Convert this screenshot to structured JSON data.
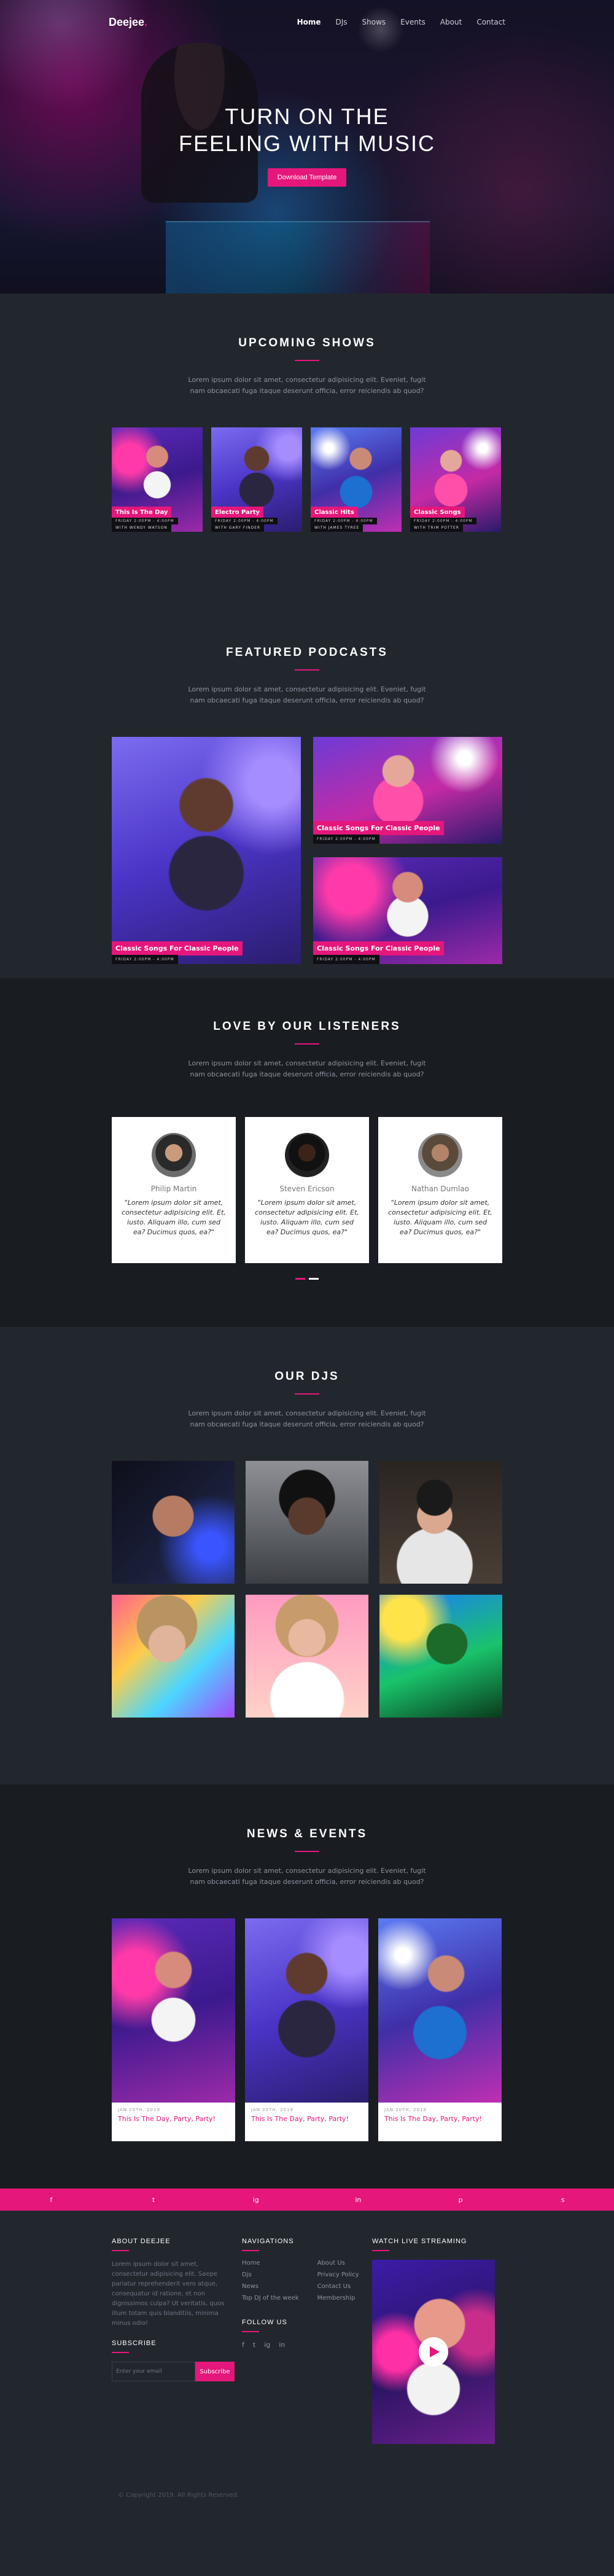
{
  "nav": {
    "logo": "Deejee",
    "logo_dot": ".",
    "items": [
      {
        "label": "Home",
        "active": true
      },
      {
        "label": "DJs",
        "active": false
      },
      {
        "label": "Shows",
        "active": false
      },
      {
        "label": "Events",
        "active": false
      },
      {
        "label": "About",
        "active": false
      },
      {
        "label": "Contact",
        "active": false
      }
    ]
  },
  "hero": {
    "line1": "TURN ON THE",
    "line2": "FEELING WITH MUSIC",
    "button": "Download Template"
  },
  "lorem": "Lorem ipsum dolor sit amet, consectetur adipisicing elit. Eveniet, fugit nam obcaecati fuga itaque deserunt officia, error reiciendis ab quod?",
  "shows": {
    "title": "UPCOMING SHOWS",
    "items": [
      {
        "title": "This Is The Day",
        "meta": "FRIDAY 2:00PM - 4:00PM",
        "host": "WITH WENDY WATSON"
      },
      {
        "title": "Electro Party",
        "meta": "FRIDAY 2:00PM - 4:00PM",
        "host": "WITH GARY FINDER"
      },
      {
        "title": "Classic Hits",
        "meta": "FRIDAY 2:00PM - 4:00PM",
        "host": "WITH JAMES TYREE"
      },
      {
        "title": "Classic Songs",
        "meta": "FRIDAY 2:00PM - 4:00PM",
        "host": "WITH TRIM POTTER"
      }
    ]
  },
  "podcasts": {
    "title": "FEATURED PODCASTS",
    "items": [
      {
        "title": "Classic Songs For Classic People",
        "meta": "FRIDAY 2:00PM - 4:00PM"
      },
      {
        "title": "Classic Songs For Classic People",
        "meta": "FRIDAY 2:00PM - 4:00PM"
      },
      {
        "title": "Classic Songs For Classic People",
        "meta": "FRIDAY 2:00PM - 4:00PM"
      }
    ]
  },
  "listeners": {
    "title": "LOVE BY OUR LISTENERS",
    "items": [
      {
        "name": "Philip Martin",
        "quote": "\"Lorem ipsum dolor sit amet, consectetur adipisicing elit. Et, iusto. Aliquam illo, cum sed ea? Ducimus quos, ea?\""
      },
      {
        "name": "Steven Ericson",
        "quote": "\"Lorem ipsum dolor sit amet, consectetur adipisicing elit. Et, iusto. Aliquam illo, cum sed ea? Ducimus quos, ea?\""
      },
      {
        "name": "Nathan Dumlao",
        "quote": "\"Lorem ipsum dolor sit amet, consectetur adipisicing elit. Et, iusto. Aliquam illo, cum sed ea? Ducimus quos, ea?\""
      }
    ]
  },
  "djs": {
    "title": "OUR DJS"
  },
  "news": {
    "title": "NEWS & EVENTS",
    "items": [
      {
        "date": "JAN 20TH, 2019",
        "title": "This Is The Day, Party, Party!"
      },
      {
        "date": "JAN 20TH, 2019",
        "title": "This Is The Day, Party, Party!"
      },
      {
        "date": "JAN 20TH, 2019",
        "title": "This Is The Day, Party, Party!"
      }
    ]
  },
  "social": [
    "f",
    "t",
    "ig",
    "in",
    "p",
    "s"
  ],
  "footer": {
    "about_title": "ABOUT DEEJEE",
    "about_text": "Lorem ipsum dolor sit amet, consectetur adipisicing elit. Saepe pariatur reprehenderit vero atque, consequatur id ratione, et non dignissimos culpa? Ut veritatis, quos illum totam quis blanditiis, minima minus odio!",
    "subscribe_title": "SUBSCRIBE",
    "subscribe_placeholder": "Enter your email",
    "subscribe_button": "Subscribe",
    "nav_title": "NAVIGATIONS",
    "nav_col1": [
      "Home",
      "Djs",
      "News",
      "Top DJ of the week"
    ],
    "nav_col2": [
      "About Us",
      "Privacy Policy",
      "Contact Us",
      "Membership"
    ],
    "follow_title": "FOLLOW US",
    "follow": [
      "f",
      "t",
      "ig",
      "in"
    ],
    "stream_title": "WATCH LIVE STREAMING",
    "copyright": "© Copyright 2019. All Rights Reserved."
  }
}
